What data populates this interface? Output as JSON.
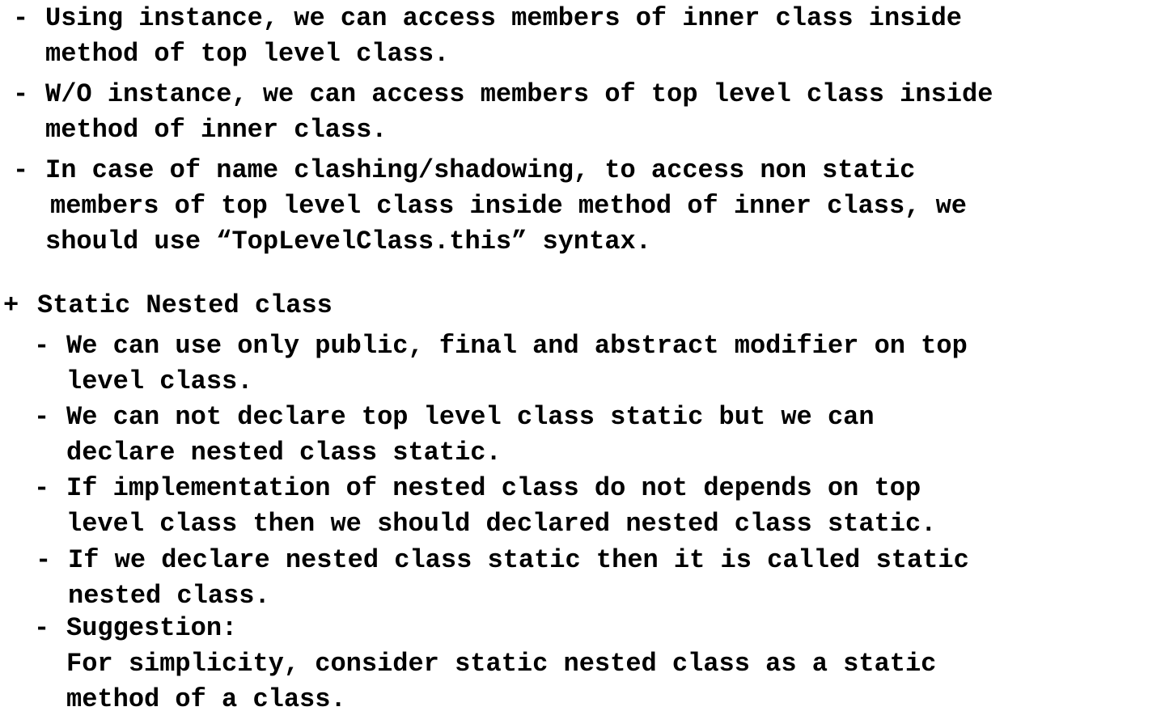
{
  "intro_points": [
    {
      "marker": "-",
      "lines": [
        "Using instance, we can access members of inner class inside",
        "method of top level class."
      ]
    },
    {
      "marker": "-",
      "lines": [
        "W/O instance, we can access members of top level class inside",
        "method of inner class."
      ]
    },
    {
      "marker": "-",
      "lines": [
        "In case of name clashing/shadowing, to access non static",
        "members of top level class inside method of inner class, we",
        "should use “TopLevelClass.this” syntax."
      ]
    }
  ],
  "section": {
    "marker": "+",
    "heading": "Static Nested class",
    "points": [
      {
        "marker": "-",
        "lines": [
          "We can use only public, final and abstract modifier on top",
          "level class."
        ]
      },
      {
        "marker": "-",
        "lines": [
          "We can not declare top level class static but we can",
          "declare nested class static."
        ]
      },
      {
        "marker": "-",
        "lines": [
          "If implementation of nested class do not depends on top",
          "level class then we should declared nested class static."
        ]
      },
      {
        "marker": "-",
        "lines": [
          "If we declare nested class static then it is called static",
          "nested class."
        ]
      },
      {
        "marker": "-",
        "lines": [
          "Suggestion:",
          "For simplicity, consider static nested class as a static",
          "method of a class."
        ]
      }
    ]
  }
}
